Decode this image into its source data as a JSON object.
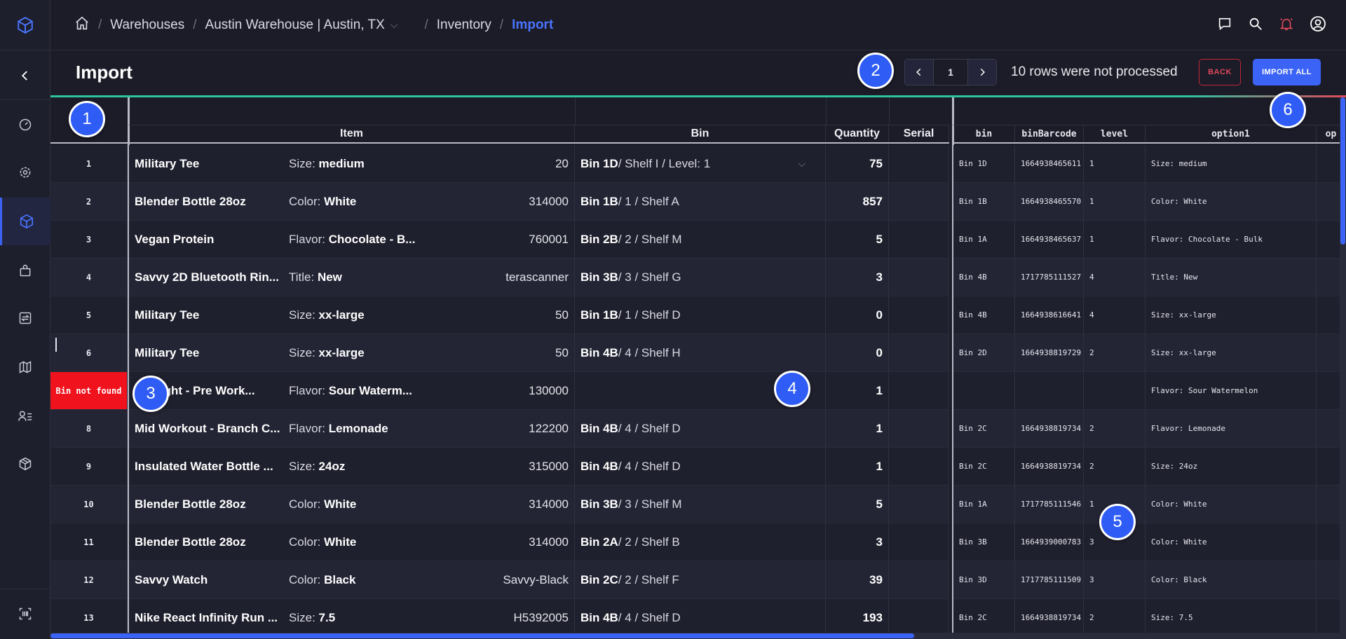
{
  "breadcrumb": {
    "items": [
      "Warehouses",
      "Austin Warehouse | Austin, TX",
      "Inventory"
    ],
    "current": "Import"
  },
  "header": {
    "title": "Import",
    "page_number": "1",
    "status_text": "10 rows were not processed",
    "back_label": "BACK",
    "import_all_label": "IMPORT ALL"
  },
  "table": {
    "columns": [
      "Item",
      "Bin",
      "Quantity",
      "Serial"
    ],
    "raw_columns": [
      "bin",
      "binBarcode",
      "level",
      "option1",
      "op"
    ],
    "rows": [
      {
        "num": "1",
        "item": "Military Tee",
        "var_label": "Size:",
        "var_value": "medium",
        "sku": "20",
        "bin_name": "Bin 1D",
        "bin_path": " / Shelf I / Level: 1",
        "qty": "75",
        "raw_bin": "Bin 1D",
        "raw_barcode": "1664938465611",
        "raw_level": "1",
        "raw_opt1": "Size: medium"
      },
      {
        "num": "2",
        "item": "Blender Bottle 28oz",
        "var_label": "Color:",
        "var_value": "White",
        "sku": "314000",
        "bin_name": "Bin 1B",
        "bin_path": " / 1 / Shelf A",
        "qty": "857",
        "raw_bin": "Bin 1B",
        "raw_barcode": "1664938465570",
        "raw_level": "1",
        "raw_opt1": "Color: White"
      },
      {
        "num": "3",
        "item": "Vegan Protein",
        "var_label": "Flavor:",
        "var_value": "Chocolate - B...",
        "sku": "760001",
        "bin_name": "Bin 2B",
        "bin_path": " / 2 / Shelf M",
        "qty": "5",
        "raw_bin": "Bin 1A",
        "raw_barcode": "1664938465637",
        "raw_level": "1",
        "raw_opt1": "Flavor: Chocolate - Bulk"
      },
      {
        "num": "4",
        "item": "Savvy 2D Bluetooth Rin...",
        "var_label": "Title:",
        "var_value": "New",
        "sku": "terascanner",
        "bin_name": "Bin 3B",
        "bin_path": " / 3 / Shelf G",
        "qty": "3",
        "raw_bin": "Bin 4B",
        "raw_barcode": "1717785111527",
        "raw_level": "4",
        "raw_opt1": "Title: New"
      },
      {
        "num": "5",
        "item": "Military Tee",
        "var_label": "Size:",
        "var_value": "xx-large",
        "sku": "50",
        "bin_name": "Bin 1B",
        "bin_path": " / 1 / Shelf D",
        "qty": "0",
        "raw_bin": "Bin 4B",
        "raw_barcode": "1664938616641",
        "raw_level": "4",
        "raw_opt1": "Size: xx-large"
      },
      {
        "num": "6",
        "item": "Military Tee",
        "var_label": "Size:",
        "var_value": "xx-large",
        "sku": "50",
        "bin_name": "Bin 4B",
        "bin_path": " / 4 / Shelf H",
        "qty": "0",
        "raw_bin": "Bin 2D",
        "raw_barcode": "1664938819729",
        "raw_level": "2",
        "raw_opt1": "Size: xx-large"
      },
      {
        "num": "Bin not found",
        "item": "...weight - Pre Work...",
        "var_label": "Flavor:",
        "var_value": "Sour Waterm...",
        "sku": "130000",
        "bin_name": "",
        "bin_path": "",
        "qty": "1",
        "raw_bin": "",
        "raw_barcode": "",
        "raw_level": "",
        "raw_opt1": "Flavor: Sour Watermelon"
      },
      {
        "num": "8",
        "item": "Mid Workout - Branch C...",
        "var_label": "Flavor:",
        "var_value": "Lemonade",
        "sku": "122200",
        "bin_name": "Bin 4B",
        "bin_path": " / 4 / Shelf D",
        "qty": "1",
        "raw_bin": "Bin 2C",
        "raw_barcode": "1664938819734",
        "raw_level": "2",
        "raw_opt1": "Flavor: Lemonade"
      },
      {
        "num": "9",
        "item": "Insulated Water Bottle ...",
        "var_label": "Size:",
        "var_value": "24oz",
        "sku": "315000",
        "bin_name": "Bin 4B",
        "bin_path": " / 4 / Shelf D",
        "qty": "1",
        "raw_bin": "Bin 2C",
        "raw_barcode": "1664938819734",
        "raw_level": "2",
        "raw_opt1": "Size: 24oz"
      },
      {
        "num": "10",
        "item": "Blender Bottle 28oz",
        "var_label": "Color:",
        "var_value": "White",
        "sku": "314000",
        "bin_name": "Bin 3B",
        "bin_path": " / 3 / Shelf M",
        "qty": "5",
        "raw_bin": "Bin 1A",
        "raw_barcode": "1717785111546",
        "raw_level": "1",
        "raw_opt1": "Color: White"
      },
      {
        "num": "11",
        "item": "Blender Bottle 28oz",
        "var_label": "Color:",
        "var_value": "White",
        "sku": "314000",
        "bin_name": "Bin 2A",
        "bin_path": " / 2 / Shelf B",
        "qty": "3",
        "raw_bin": "Bin 3B",
        "raw_barcode": "1664939000783",
        "raw_level": "3",
        "raw_opt1": "Color: White"
      },
      {
        "num": "12",
        "item": "Savvy Watch",
        "var_label": "Color:",
        "var_value": "Black",
        "sku": "Savvy-Black",
        "bin_name": "Bin 2C",
        "bin_path": " / 2 / Shelf F",
        "qty": "39",
        "raw_bin": "Bin 3D",
        "raw_barcode": "1717785111509",
        "raw_level": "3",
        "raw_opt1": "Color: Black"
      },
      {
        "num": "13",
        "item": "Nike React Infinity Run ...",
        "var_label": "Size:",
        "var_value": "7.5",
        "sku": "H5392005",
        "bin_name": "Bin 4B",
        "bin_path": " / 4 / Shelf D",
        "qty": "193",
        "raw_bin": "Bin 2C",
        "raw_barcode": "1664938819734",
        "raw_level": "2",
        "raw_opt1": "Size: 7.5"
      }
    ]
  },
  "badges": [
    "1",
    "2",
    "3",
    "4",
    "5",
    "6"
  ],
  "colors": {
    "accent": "#3b63f6",
    "error": "#f0121d",
    "background": "#1b1c27"
  },
  "icons": {
    "logo": "cube-logo-icon",
    "nav": [
      "collapse-chevron-icon",
      "dashboard-gauge-icon",
      "settings-gear-icon",
      "inventory-box-icon",
      "bag-icon",
      "transfer-icon",
      "map-icon",
      "users-list-icon",
      "package-icon",
      "barcode-scan-icon"
    ],
    "top": [
      "chat-icon",
      "search-icon",
      "notification-bell-icon",
      "user-account-icon"
    ]
  }
}
